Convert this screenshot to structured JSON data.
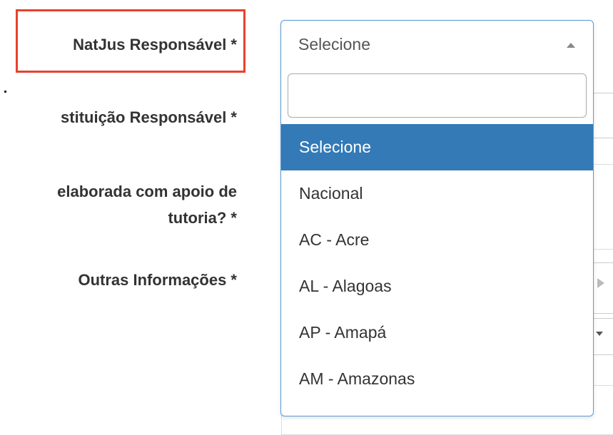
{
  "form": {
    "labels": [
      "NatJus Responsável *",
      "stituição Responsável *",
      "elaborada com apoio de",
      "tutoria? *",
      "Outras Informações *"
    ]
  },
  "select": {
    "value": "Selecione",
    "search_value": "",
    "options": [
      "Selecione",
      "Nacional",
      "AC - Acre",
      "AL - Alagoas",
      "AP - Amapá",
      "AM - Amazonas"
    ],
    "highlighted_index": 0
  },
  "colors": {
    "highlight_border": "#e8412c",
    "selected_option_bg": "#337ab7",
    "dropdown_border": "#5b9bd5"
  },
  "icons": {
    "select_caret": "caret-up-icon",
    "field_arrow": "arrow-right-icon",
    "field_caret": "caret-down-icon"
  }
}
